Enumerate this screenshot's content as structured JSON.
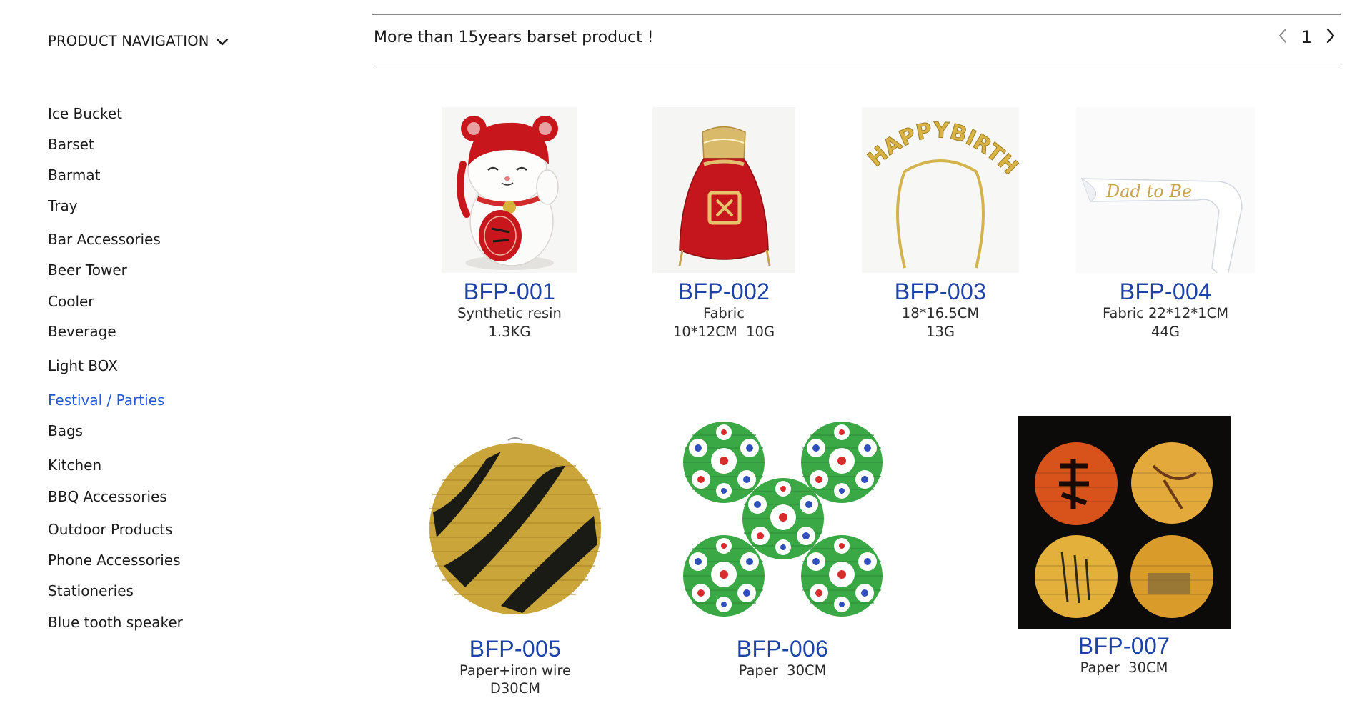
{
  "sidebar": {
    "title": "PRODUCT NAVIGATION",
    "items": [
      {
        "label": "Ice Bucket"
      },
      {
        "label": "Barset"
      },
      {
        "label": "Barmat"
      },
      {
        "label": "Tray"
      },
      {
        "label": "Bar Accessories"
      },
      {
        "label": "Beer Tower"
      },
      {
        "label": "Cooler"
      },
      {
        "label": "Beverage"
      },
      {
        "label": "Light BOX"
      },
      {
        "label": "Festival / Parties"
      },
      {
        "label": "Bags"
      },
      {
        "label": "Kitchen"
      },
      {
        "label": "BBQ Accessories"
      },
      {
        "label": "Outdoor Products"
      },
      {
        "label": "Phone Accessories"
      },
      {
        "label": "Stationeries"
      },
      {
        "label": "Blue tooth speaker"
      }
    ],
    "active_item": "Festival / Parties"
  },
  "header": {
    "tagline": "More than 15years barset product !",
    "page": "1"
  },
  "products": [
    {
      "code": "BFP-001",
      "spec1": "Synthetic resin",
      "spec2": "1.3KG"
    },
    {
      "code": "BFP-002",
      "spec1": "Fabric",
      "spec2": "10*12CM  10G"
    },
    {
      "code": "BFP-003",
      "spec1": "18*16.5CM",
      "spec2": "13G"
    },
    {
      "code": "BFP-004",
      "spec1": "Fabric 22*12*1CM",
      "spec2": "44G"
    },
    {
      "code": "BFP-005",
      "spec1": "Paper+iron wire",
      "spec2": "D30CM"
    },
    {
      "code": "BFP-006",
      "spec1": "Paper  30CM",
      "spec2": ""
    },
    {
      "code": "BFP-007",
      "spec1": "Paper  30CM",
      "spec2": ""
    },
    {
      "headband_text": "HAPPYBIRTHDAY",
      "sash_text": "Dad to Be"
    }
  ],
  "colors": {
    "accent": "#2458d6",
    "product_code": "#1d43a8",
    "divider": "#8a8a8a"
  },
  "icons": [
    "chevron-down-icon",
    "chevron-left-icon",
    "chevron-right-icon"
  ]
}
